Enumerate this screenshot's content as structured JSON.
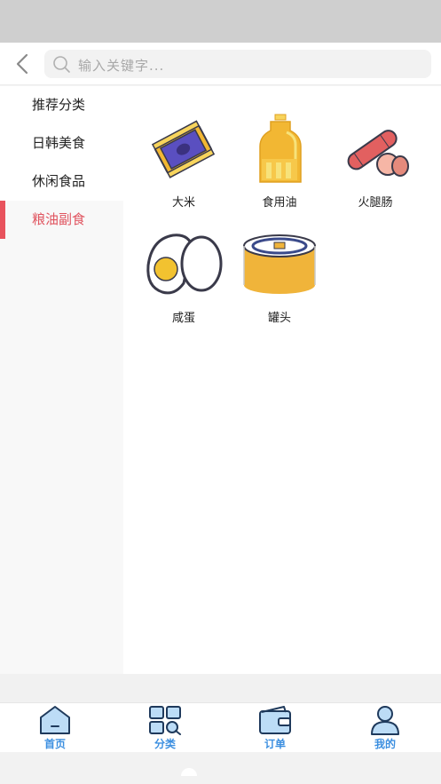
{
  "search": {
    "placeholder": "输入关键字..."
  },
  "sidebar": {
    "items": [
      {
        "label": "推荐分类",
        "active": false
      },
      {
        "label": "日韩美食",
        "active": false
      },
      {
        "label": "休闲食品",
        "active": false
      },
      {
        "label": "粮油副食",
        "active": true
      }
    ]
  },
  "products": [
    {
      "name": "大米",
      "icon": "rice-bag-icon"
    },
    {
      "name": "食用油",
      "icon": "oil-bottle-icon"
    },
    {
      "name": "火腿肠",
      "icon": "sausage-icon"
    },
    {
      "name": "咸蛋",
      "icon": "salted-egg-icon"
    },
    {
      "name": "罐头",
      "icon": "canned-food-icon"
    }
  ],
  "tabbar": {
    "items": [
      {
        "label": "首页",
        "icon": "home-icon"
      },
      {
        "label": "分类",
        "icon": "category-icon"
      },
      {
        "label": "订单",
        "icon": "wallet-icon"
      },
      {
        "label": "我的",
        "icon": "user-icon"
      }
    ]
  },
  "colors": {
    "accent": "#e8535d",
    "tab": "#3c8fe0"
  }
}
